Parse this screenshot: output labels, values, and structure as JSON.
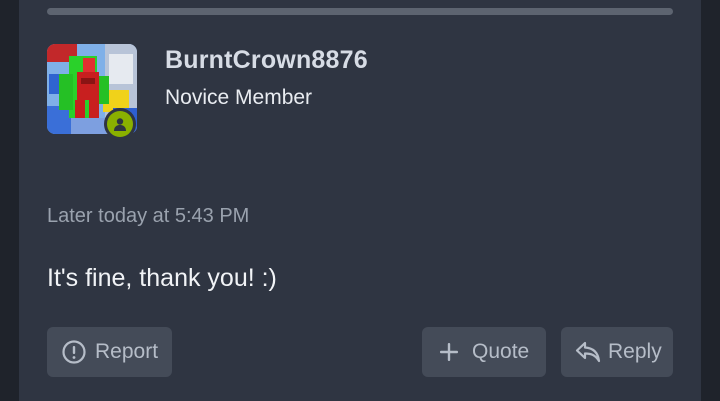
{
  "post": {
    "username": "BurntCrown8876",
    "user_title": "Novice Member",
    "timestamp": "Later today at 5:43 PM",
    "message": "It's fine, thank you! :)",
    "online_status_icon": "user-online-icon",
    "colors": {
      "card_background": "#2f3542",
      "page_background": "#1f232b",
      "button_background": "#444b58",
      "online_badge": "#8ab000"
    }
  },
  "actions": {
    "report_label": "Report",
    "report_icon": "alert-circle-icon",
    "quote_label": "Quote",
    "quote_icon": "plus-icon",
    "reply_label": "Reply",
    "reply_icon": "reply-arrow-icon"
  }
}
